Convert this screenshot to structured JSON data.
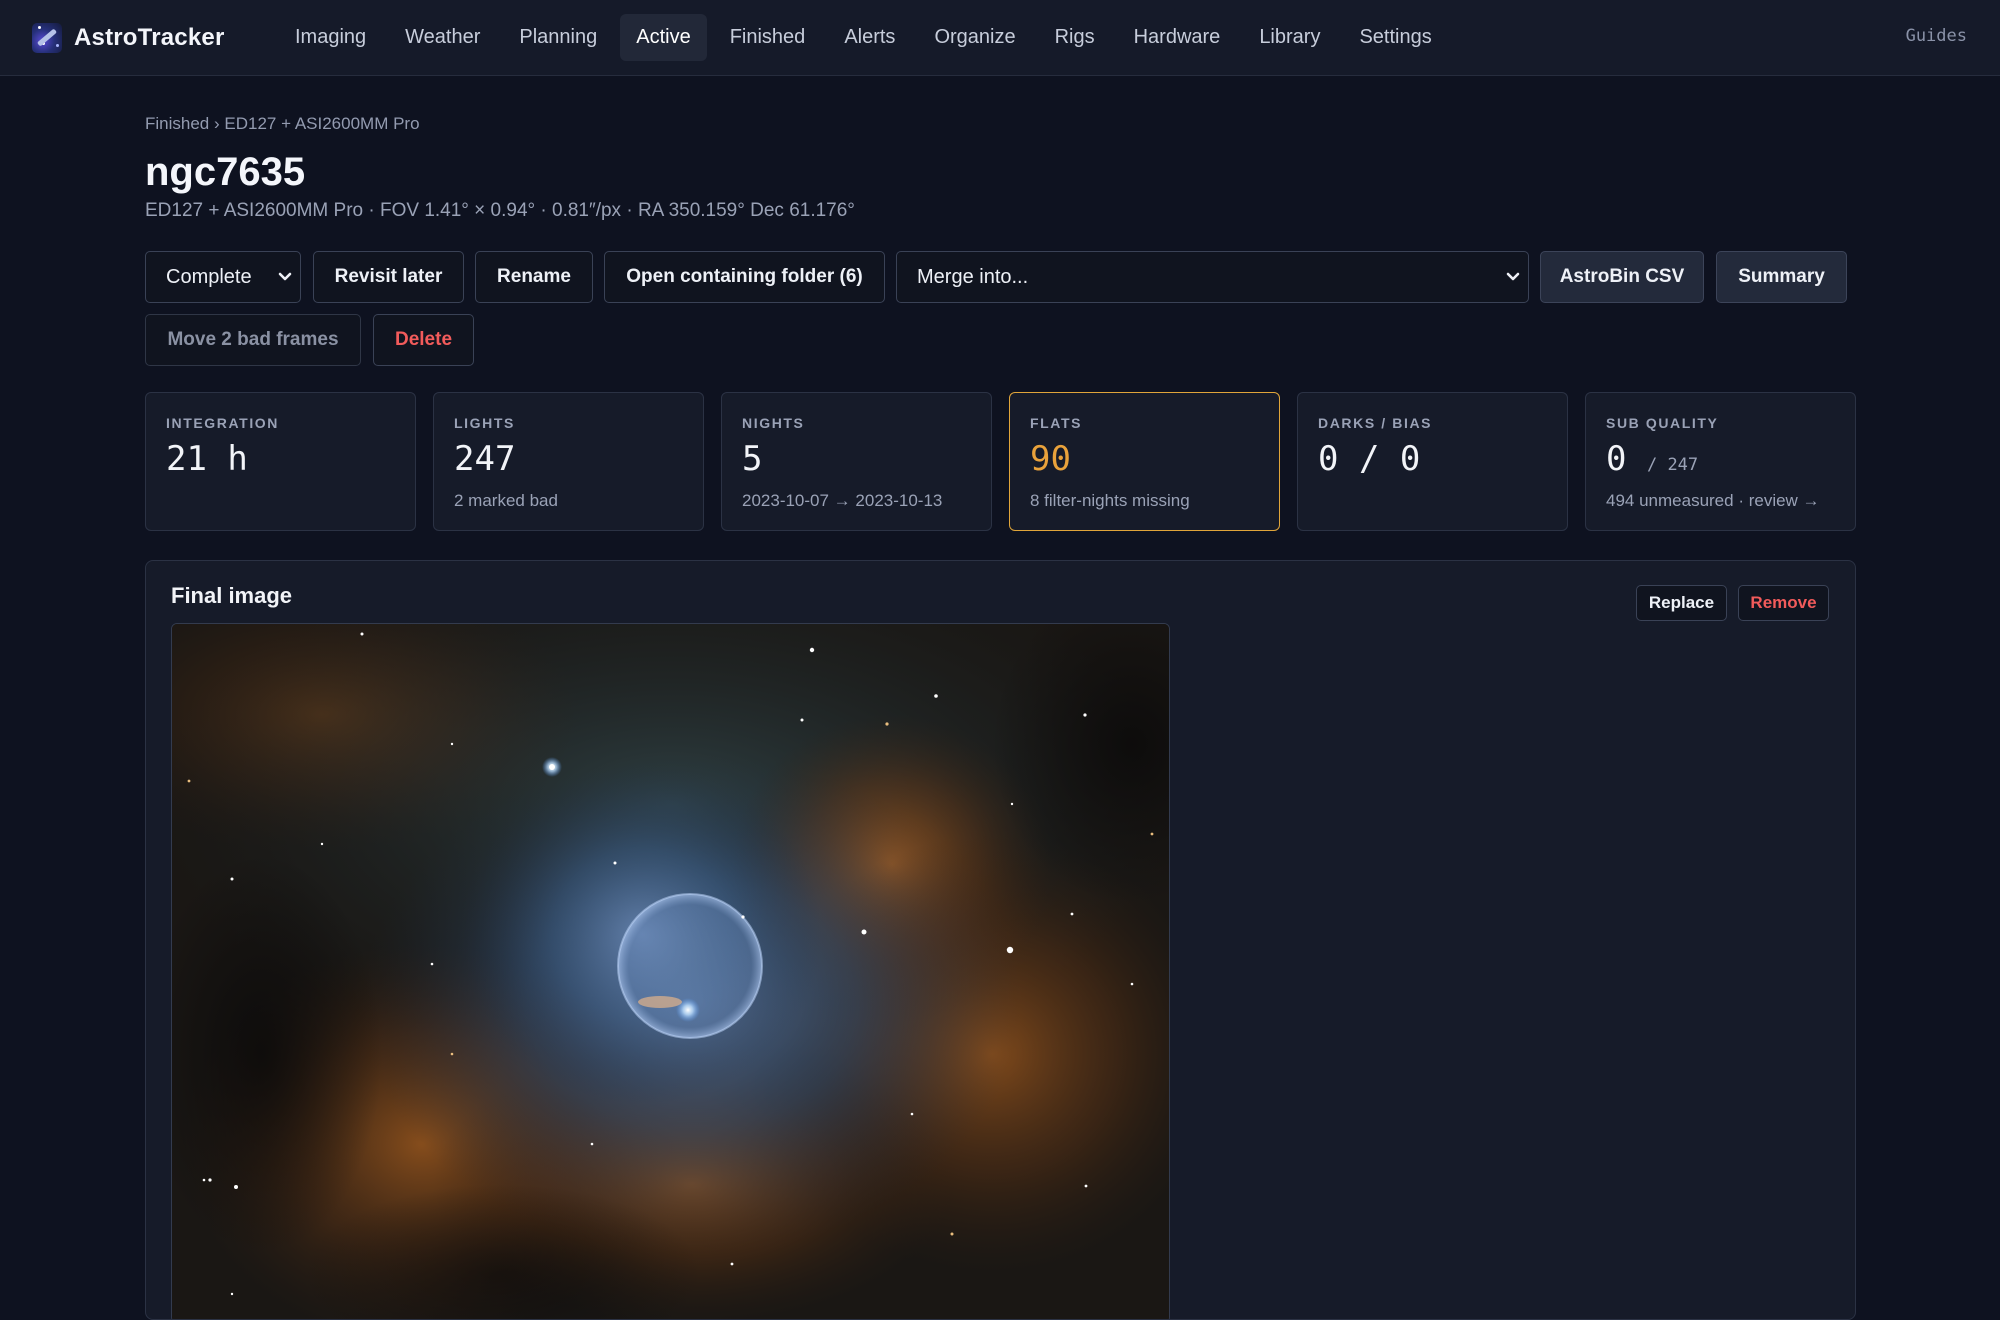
{
  "app": {
    "name": "AstroTracker",
    "guides_label": "Guides"
  },
  "nav": {
    "items": [
      {
        "label": "Imaging"
      },
      {
        "label": "Weather"
      },
      {
        "label": "Planning"
      },
      {
        "label": "Active",
        "active": true
      },
      {
        "label": "Finished"
      },
      {
        "label": "Alerts"
      },
      {
        "label": "Organize"
      },
      {
        "label": "Rigs"
      },
      {
        "label": "Hardware"
      },
      {
        "label": "Library"
      },
      {
        "label": "Settings"
      }
    ]
  },
  "breadcrumb": {
    "parent": "Finished",
    "separator": "›",
    "current": "ED127 + ASI2600MM Pro"
  },
  "project": {
    "title": "ngc7635",
    "subtitle": "ED127 + ASI2600MM Pro · FOV 1.41° × 0.94° · 0.81″/px · RA 350.159° Dec 61.176°"
  },
  "actions": {
    "status_select": "Complete",
    "revisit_later": "Revisit later",
    "rename": "Rename",
    "open_folder": "Open containing folder (6)",
    "merge_select": "Merge into...",
    "astrobin_csv": "AstroBin CSV",
    "summary": "Summary",
    "move_bad_frames": "Move 2 bad frames",
    "delete": "Delete"
  },
  "stats": {
    "integration": {
      "label": "INTEGRATION",
      "value": "21 h"
    },
    "lights": {
      "label": "LIGHTS",
      "value": "247",
      "sub": "2 marked bad"
    },
    "nights": {
      "label": "NIGHTS",
      "value": "5",
      "sub": "2023-10-07 → 2023-10-13"
    },
    "flats": {
      "label": "FLATS",
      "value": "90",
      "sub": "8 filter-nights missing"
    },
    "darks_bias": {
      "label": "DARKS / BIAS",
      "value": "0 / 0"
    },
    "sub_quality": {
      "label": "SUB QUALITY",
      "value": "0",
      "total": "/ 247",
      "sub": "494 unmeasured · review →"
    }
  },
  "final_image": {
    "title": "Final image",
    "replace": "Replace",
    "remove": "Remove"
  },
  "colors": {
    "background": "#0e1220",
    "card": "#161b29",
    "accent_warning": "#e9a23b",
    "danger": "#f25b5b"
  }
}
